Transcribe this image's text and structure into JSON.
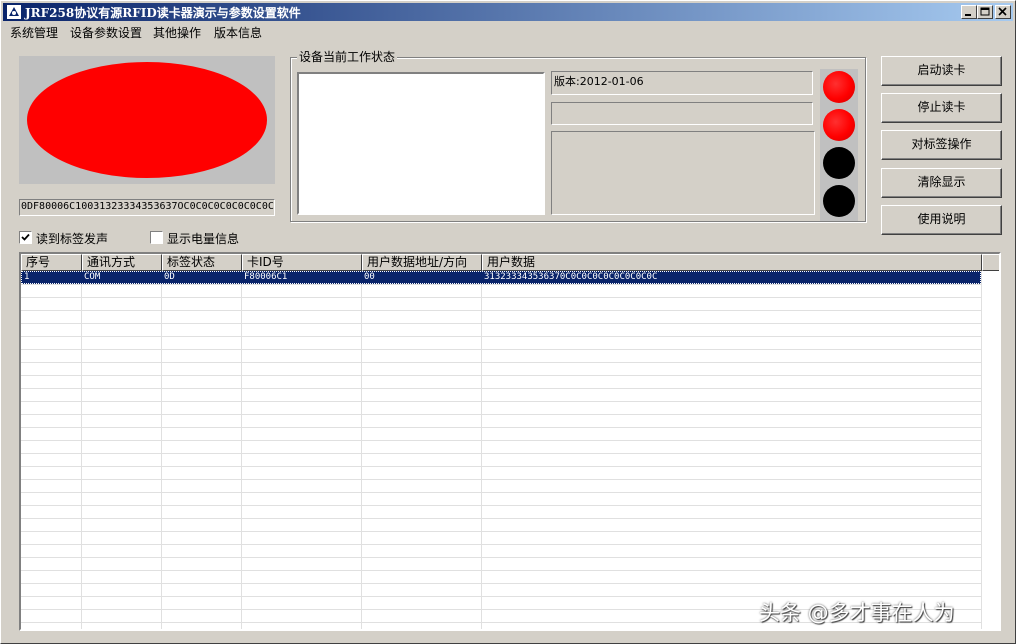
{
  "window": {
    "title": "JRF258协议有源RFID读卡器演示与参数设置软件",
    "controls": [
      "minimize-icon",
      "maximize-icon",
      "close-icon"
    ]
  },
  "menu": {
    "items": [
      "系统管理",
      "设备参数设置",
      "其他操作",
      "版本信息"
    ]
  },
  "indicator": {
    "color": "#ff0000"
  },
  "hex_display": {
    "value": "0DF80006C10031323334353637OC0C0C0C0C0C0C0C0C"
  },
  "status_group": {
    "label": "设备当前工作状态",
    "version": "版本:2012-01-06",
    "lights": [
      "red",
      "red",
      "black",
      "black"
    ]
  },
  "buttons": {
    "start": "启动读卡",
    "stop": "停止读卡",
    "tag_op": "对标签操作",
    "clear": "清除显示",
    "help": "使用说明"
  },
  "checkboxes": {
    "beep": {
      "label": "读到标签发声",
      "checked": true
    },
    "battery": {
      "label": "显示电量信息",
      "checked": false
    }
  },
  "table": {
    "columns": [
      "序号",
      "通讯方式",
      "标签状态",
      "卡ID号",
      "用户数据地址/方向",
      "用户数据"
    ],
    "rows": [
      [
        "1",
        "COM",
        "0D",
        "F80006C1",
        "00",
        "313233343536370C0C0C0C0C0C0C0C0C"
      ]
    ]
  },
  "watermark": "头条 @多才事在人为"
}
